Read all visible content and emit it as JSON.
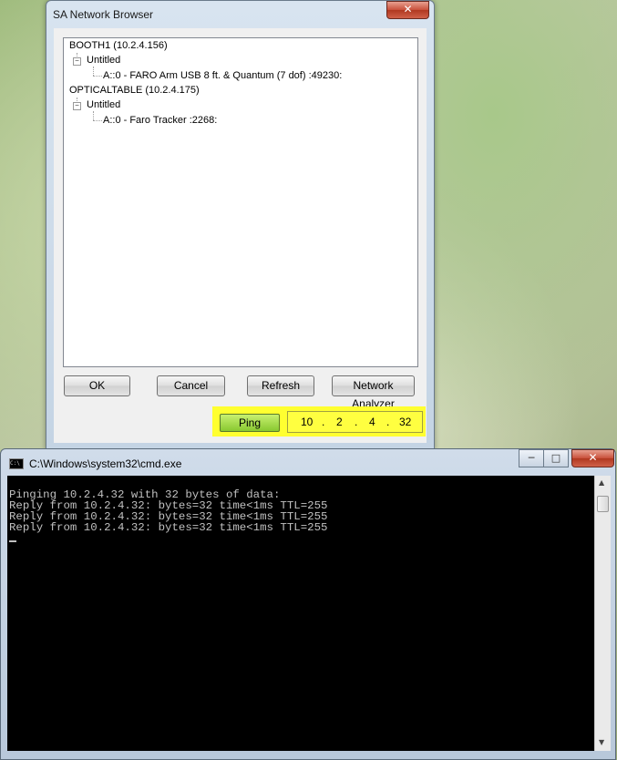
{
  "browser": {
    "title": "SA Network Browser",
    "close_glyph": "✕",
    "tree": {
      "nodes": [
        {
          "label": "BOOTH1 (10.2.4.156)"
        },
        {
          "label": "Untitled"
        },
        {
          "label": "A::0 - FARO Arm USB 8 ft. & Quantum (7 dof)  :49230:"
        },
        {
          "label": "OPTICALTABLE (10.2.4.175)"
        },
        {
          "label": "Untitled"
        },
        {
          "label": "A::0 - Faro Tracker  :2268:"
        }
      ],
      "collapse_glyph": "−"
    },
    "buttons": {
      "ok": "OK",
      "cancel": "Cancel",
      "refresh": "Refresh",
      "network_analyzer": "Network Analyzer"
    },
    "ping": {
      "label": "Ping",
      "ip": [
        "10",
        "2",
        "4",
        "32"
      ],
      "dot": "."
    }
  },
  "cmd": {
    "title": "C:\\Windows\\system32\\cmd.exe",
    "icon_text": "C:\\",
    "minimize_glyph": "─",
    "maximize_glyph": "□",
    "close_glyph": "✕",
    "lines": [
      "Pinging 10.2.4.32 with 32 bytes of data:",
      "Reply from 10.2.4.32: bytes=32 time<1ms TTL=255",
      "Reply from 10.2.4.32: bytes=32 time<1ms TTL=255",
      "Reply from 10.2.4.32: bytes=32 time<1ms TTL=255"
    ],
    "scroll_up_glyph": "▲",
    "scroll_down_glyph": "▼"
  }
}
